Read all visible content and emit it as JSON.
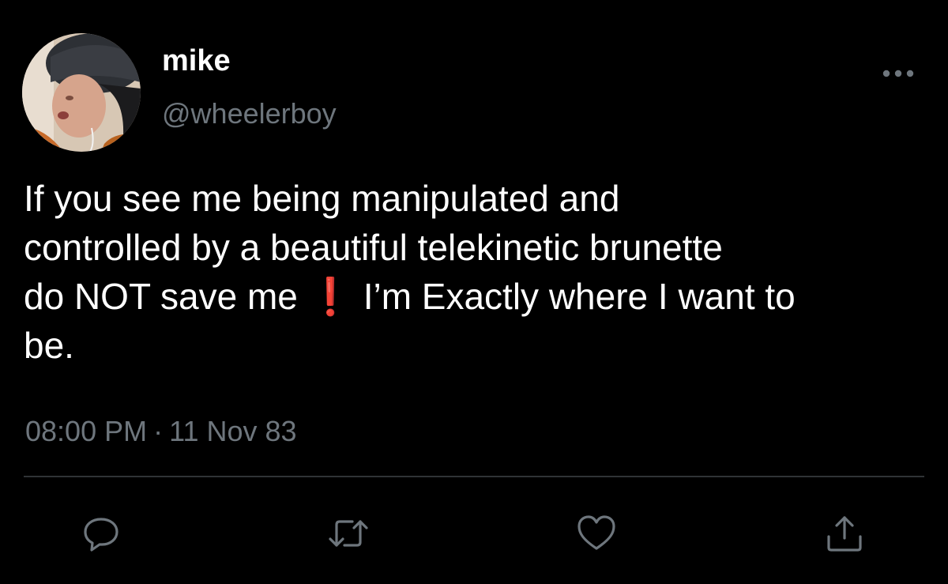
{
  "colors": {
    "background": "#000000",
    "primary_text": "#ffffff",
    "secondary_text": "#6e767d",
    "divider": "#2f3336",
    "emoji_red": "#e0242b"
  },
  "tweet": {
    "author": {
      "display_name": "mike",
      "handle": "@wheelerboy",
      "avatar_icon": "profile-photo"
    },
    "body_lines": [
      "If you see me being manipulated and",
      "controlled by a beautiful telekinetic brunette",
      "do NOT save me",
      "I’m Exactly where I want to",
      "be."
    ],
    "emoji": "❗",
    "time": "08:00 PM",
    "separator": "·",
    "date": "11 Nov 83"
  },
  "actions": [
    {
      "name": "reply",
      "icon": "speech-bubble-icon"
    },
    {
      "name": "retweet",
      "icon": "retweet-icon"
    },
    {
      "name": "like",
      "icon": "heart-icon"
    },
    {
      "name": "share",
      "icon": "share-icon"
    }
  ],
  "more_icon": "ellipsis-icon"
}
